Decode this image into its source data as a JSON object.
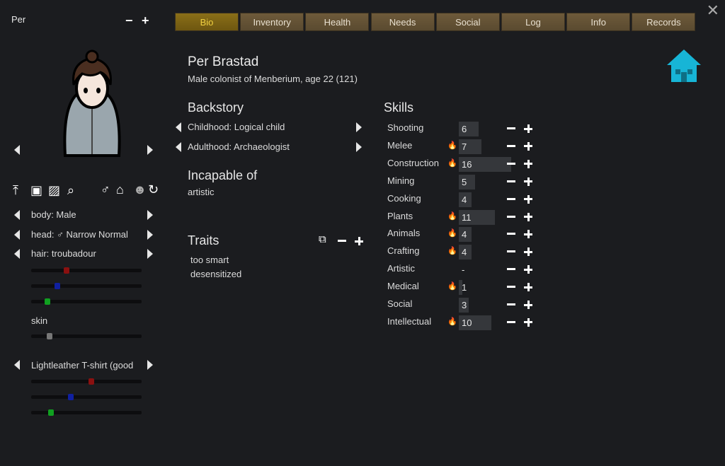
{
  "pawn": {
    "short_name": "Per",
    "full_name": "Per Brastad",
    "description": "Male colonist of Menberium, age 22 (121)"
  },
  "tabs": [
    {
      "label": "Bio",
      "active": true
    },
    {
      "label": "Inventory"
    },
    {
      "label": "Health"
    },
    {
      "label": "Needs"
    },
    {
      "label": "Social"
    },
    {
      "label": "Log"
    },
    {
      "label": "Info"
    },
    {
      "label": "Records"
    }
  ],
  "editor": {
    "body_label": "body: Male",
    "head_label": "head: ♂ Narrow Normal",
    "hair_label": "hair: troubadour",
    "skin_label": "skin",
    "apparel_label": "Lightleather T-shirt (good",
    "icons": [
      "upload-icon",
      "save-icon",
      "stripes-icon",
      "search-icon",
      "male-gender-icon",
      "hanger-icon",
      "alien-icon",
      "rotate-icon"
    ],
    "hair_color": {
      "r": 0.31,
      "g": 0.13,
      "b": 0.22
    },
    "skin_level": 0.15,
    "apparel_color": {
      "r": 0.55,
      "g": 0.16,
      "b": 0.35
    }
  },
  "backstory": {
    "title": "Backstory",
    "childhood": "Childhood: Logical child",
    "adulthood": "Adulthood: Archaeologist"
  },
  "incapable": {
    "title": "Incapable of",
    "items": "artistic"
  },
  "traits": {
    "title": "Traits",
    "items": [
      "too smart",
      "desensitized"
    ]
  },
  "skills": {
    "title": "Skills",
    "max": 20,
    "list": [
      {
        "name": "Shooting",
        "value": "6",
        "passion": false
      },
      {
        "name": "Melee",
        "value": "7",
        "passion": true
      },
      {
        "name": "Construction",
        "value": "16",
        "passion": true
      },
      {
        "name": "Mining",
        "value": "5",
        "passion": false
      },
      {
        "name": "Cooking",
        "value": "4",
        "passion": false
      },
      {
        "name": "Plants",
        "value": "11",
        "passion": true
      },
      {
        "name": "Animals",
        "value": "4",
        "passion": true
      },
      {
        "name": "Crafting",
        "value": "4",
        "passion": true
      },
      {
        "name": "Artistic",
        "value": "-",
        "passion": false
      },
      {
        "name": "Medical",
        "value": "1",
        "passion": true
      },
      {
        "name": "Social",
        "value": "3",
        "passion": false
      },
      {
        "name": "Intellectual",
        "value": "10",
        "passion": true
      }
    ]
  },
  "colors": {
    "tab_active_text": "#f0d040",
    "passion": "#f0a020",
    "home_icon": "#17b5d6"
  }
}
